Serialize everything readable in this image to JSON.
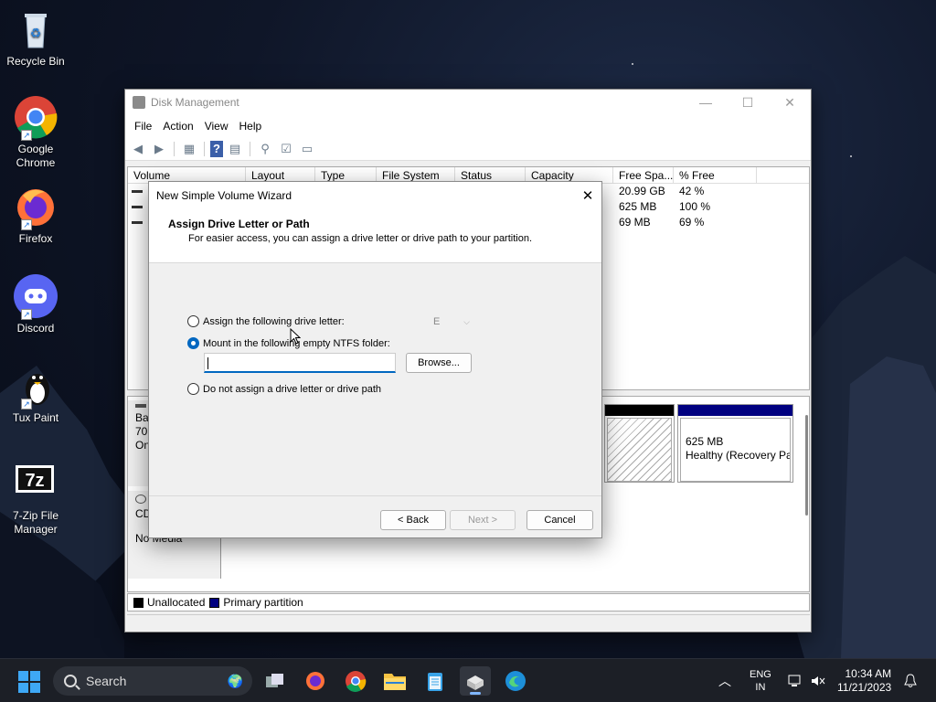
{
  "desktop": {
    "icons": [
      {
        "label": "Recycle Bin",
        "icon": "recycle-bin-icon"
      },
      {
        "label": "Google Chrome",
        "icon": "chrome-icon"
      },
      {
        "label": "Firefox",
        "icon": "firefox-icon"
      },
      {
        "label": "Discord",
        "icon": "discord-icon"
      },
      {
        "label": "Tux Paint",
        "icon": "tux-paint-icon"
      },
      {
        "label": "7-Zip File Manager",
        "icon": "seven-zip-icon"
      }
    ]
  },
  "window": {
    "title": "Disk Management",
    "menu": [
      "File",
      "Action",
      "View",
      "Help"
    ],
    "columns": [
      "Volume",
      "Layout",
      "Type",
      "File System",
      "Status",
      "Capacity",
      "Free Spa...",
      "% Free"
    ],
    "rows": [
      {
        "free": "20.99 GB",
        "pct": "42 %"
      },
      {
        "free": "625 MB",
        "pct": "100 %"
      },
      {
        "free": "69 MB",
        "pct": "69 %"
      }
    ],
    "disk0": {
      "label_line1": "Ba",
      "label_line2": "70.",
      "label_line3": "On"
    },
    "recovery_partition": {
      "size": "625 MB",
      "status": "Healthy (Recovery Pa"
    },
    "cdrom": {
      "label": "CD",
      "media": "No Media"
    },
    "legend": {
      "unallocated": "Unallocated",
      "primary": "Primary partition"
    },
    "colors": {
      "unallocated": "#000000",
      "primary": "#000080"
    }
  },
  "wizard": {
    "title": "New Simple Volume Wizard",
    "header_title": "Assign Drive Letter or Path",
    "header_desc": "For easier access, you can assign a drive letter or drive path to your partition.",
    "option_letter": "Assign the following drive letter:",
    "drive_letter": "E",
    "option_folder": "Mount in the following empty NTFS folder:",
    "folder_value": "",
    "browse": "Browse...",
    "option_none": "Do not assign a drive letter or drive path",
    "back": "< Back",
    "next": "Next >",
    "cancel": "Cancel",
    "selected_option": "folder"
  },
  "taskbar": {
    "search_label": "Search",
    "lang_line1": "ENG",
    "lang_line2": "IN",
    "time": "10:34 AM",
    "date": "11/21/2023",
    "accent": "#3ea8f5"
  }
}
